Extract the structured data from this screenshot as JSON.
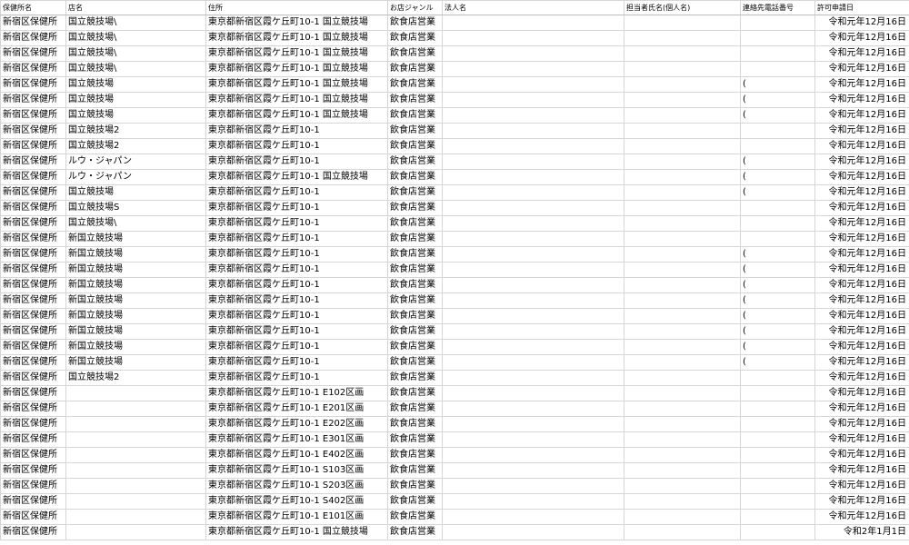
{
  "columns": [
    "保健所名",
    "店名",
    "住所",
    "お店ジャンル",
    "法人名",
    "担当者氏名(個人名)",
    "連絡先電話番号",
    "許可申請日"
  ],
  "rows": [
    [
      "新宿区保健所",
      "国立競技場\\",
      "東京都新宿区霞ケ丘町10-1 国立競技場",
      "飲食店営業",
      "",
      "",
      "",
      "令和元年12月16日"
    ],
    [
      "新宿区保健所",
      "国立競技場\\",
      "東京都新宿区霞ケ丘町10-1 国立競技場",
      "飲食店営業",
      "",
      "",
      "",
      "令和元年12月16日"
    ],
    [
      "新宿区保健所",
      "国立競技場\\",
      "東京都新宿区霞ケ丘町10-1 国立競技場",
      "飲食店営業",
      "",
      "",
      "",
      "令和元年12月16日"
    ],
    [
      "新宿区保健所",
      "国立競技場\\",
      "東京都新宿区霞ケ丘町10-1 国立競技場",
      "飲食店営業",
      "",
      "",
      "",
      "令和元年12月16日"
    ],
    [
      "新宿区保健所",
      "国立競技場",
      "東京都新宿区霞ケ丘町10-1 国立競技場",
      "飲食店営業",
      "",
      "",
      "(",
      "令和元年12月16日"
    ],
    [
      "新宿区保健所",
      "国立競技場",
      "東京都新宿区霞ケ丘町10-1 国立競技場",
      "飲食店営業",
      "",
      "",
      "(",
      "令和元年12月16日"
    ],
    [
      "新宿区保健所",
      "国立競技場",
      "東京都新宿区霞ケ丘町10-1 国立競技場",
      "飲食店営業",
      "",
      "",
      "(",
      "令和元年12月16日"
    ],
    [
      "新宿区保健所",
      "国立競技場2",
      "東京都新宿区霞ケ丘町10-1",
      "飲食店営業",
      "",
      "",
      "",
      "令和元年12月16日"
    ],
    [
      "新宿区保健所",
      "国立競技場2",
      "東京都新宿区霞ケ丘町10-1",
      "飲食店営業",
      "",
      "",
      "",
      "令和元年12月16日"
    ],
    [
      "新宿区保健所",
      "ルウ・ジャパン",
      "東京都新宿区霞ケ丘町10-1",
      "飲食店営業",
      "",
      "",
      "(",
      "令和元年12月16日"
    ],
    [
      "新宿区保健所",
      "ルウ・ジャパン",
      "東京都新宿区霞ケ丘町10-1 国立競技場",
      "飲食店営業",
      "",
      "",
      "(",
      "令和元年12月16日"
    ],
    [
      "新宿区保健所",
      "国立競技場",
      "東京都新宿区霞ケ丘町10-1",
      "飲食店営業",
      "",
      "",
      "(",
      "令和元年12月16日"
    ],
    [
      "新宿区保健所",
      "国立競技場S",
      "東京都新宿区霞ケ丘町10-1",
      "飲食店営業",
      "",
      "",
      "",
      "令和元年12月16日"
    ],
    [
      "新宿区保健所",
      "国立競技場\\",
      "東京都新宿区霞ケ丘町10-1",
      "飲食店営業",
      "",
      "",
      "",
      "令和元年12月16日"
    ],
    [
      "新宿区保健所",
      "新国立競技場",
      "東京都新宿区霞ケ丘町10-1",
      "飲食店営業",
      "",
      "",
      "",
      "令和元年12月16日"
    ],
    [
      "新宿区保健所",
      "新国立競技場",
      "東京都新宿区霞ケ丘町10-1",
      "飲食店営業",
      "",
      "",
      "(",
      "令和元年12月16日"
    ],
    [
      "新宿区保健所",
      "新国立競技場",
      "東京都新宿区霞ケ丘町10-1",
      "飲食店営業",
      "",
      "",
      "(",
      "令和元年12月16日"
    ],
    [
      "新宿区保健所",
      "新国立競技場",
      "東京都新宿区霞ケ丘町10-1",
      "飲食店営業",
      "",
      "",
      "(",
      "令和元年12月16日"
    ],
    [
      "新宿区保健所",
      "新国立競技場",
      "東京都新宿区霞ケ丘町10-1",
      "飲食店営業",
      "",
      "",
      "(",
      "令和元年12月16日"
    ],
    [
      "新宿区保健所",
      "新国立競技場",
      "東京都新宿区霞ケ丘町10-1",
      "飲食店営業",
      "",
      "",
      "(",
      "令和元年12月16日"
    ],
    [
      "新宿区保健所",
      "新国立競技場",
      "東京都新宿区霞ケ丘町10-1",
      "飲食店営業",
      "",
      "",
      "(",
      "令和元年12月16日"
    ],
    [
      "新宿区保健所",
      "新国立競技場",
      "東京都新宿区霞ケ丘町10-1",
      "飲食店営業",
      "",
      "",
      "(",
      "令和元年12月16日"
    ],
    [
      "新宿区保健所",
      "新国立競技場",
      "東京都新宿区霞ケ丘町10-1",
      "飲食店営業",
      "",
      "",
      "(",
      "令和元年12月16日"
    ],
    [
      "新宿区保健所",
      "国立競技場2",
      "東京都新宿区霞ケ丘町10-1",
      "飲食店営業",
      "",
      "",
      "",
      "令和元年12月16日"
    ],
    [
      "新宿区保健所",
      "",
      "東京都新宿区霞ケ丘町10-1 E102区画",
      "飲食店営業",
      "",
      "",
      "",
      "令和元年12月16日"
    ],
    [
      "新宿区保健所",
      "",
      "東京都新宿区霞ケ丘町10-1 E201区画",
      "飲食店営業",
      "",
      "",
      "",
      "令和元年12月16日"
    ],
    [
      "新宿区保健所",
      "",
      "東京都新宿区霞ケ丘町10-1 E202区画",
      "飲食店営業",
      "",
      "",
      "",
      "令和元年12月16日"
    ],
    [
      "新宿区保健所",
      "",
      "東京都新宿区霞ケ丘町10-1 E301区画",
      "飲食店営業",
      "",
      "",
      "",
      "令和元年12月16日"
    ],
    [
      "新宿区保健所",
      "",
      "東京都新宿区霞ケ丘町10-1 E402区画",
      "飲食店営業",
      "",
      "",
      "",
      "令和元年12月16日"
    ],
    [
      "新宿区保健所",
      "",
      "東京都新宿区霞ケ丘町10-1 S103区画",
      "飲食店営業",
      "",
      "",
      "",
      "令和元年12月16日"
    ],
    [
      "新宿区保健所",
      "",
      "東京都新宿区霞ケ丘町10-1 S203区画",
      "飲食店営業",
      "",
      "",
      "",
      "令和元年12月16日"
    ],
    [
      "新宿区保健所",
      "",
      "東京都新宿区霞ケ丘町10-1 S402区画",
      "飲食店営業",
      "",
      "",
      "",
      "令和元年12月16日"
    ],
    [
      "新宿区保健所",
      "",
      "東京都新宿区霞ケ丘町10-1 E101区画",
      "飲食店営業",
      "",
      "",
      "",
      "令和元年12月16日"
    ],
    [
      "新宿区保健所",
      "",
      "東京都新宿区霞ケ丘町10-1 国立競技場",
      "飲食店営業",
      "",
      "",
      "",
      "令和2年1月1日"
    ]
  ]
}
